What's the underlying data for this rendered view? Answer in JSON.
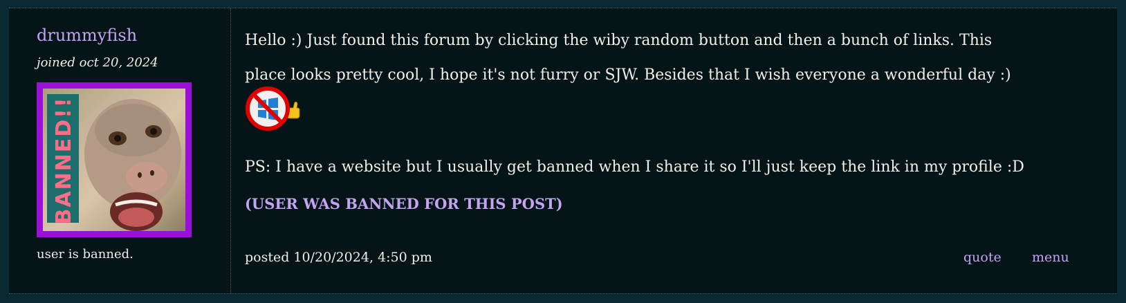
{
  "post": {
    "author": {
      "username": "drummyfish",
      "joined": "joined oct 20, 2024",
      "avatar_label": "BANNED!!",
      "status": "user is banned."
    },
    "body": {
      "text": "Hello :) Just found this forum by clicking the wiby random button and then a bunch of links. This place looks pretty cool, I hope it's not furry or SJW. Besides that I wish everyone a wonderful day :)",
      "ps": "PS: I have a website but I usually get banned when I share it so I'll just keep the link in my profile :D",
      "ban_notice": "(USER WAS BANNED FOR THIS POST)"
    },
    "footer": {
      "posted": "posted 10/20/2024, 4:50 pm",
      "quote_label": "quote",
      "menu_label": "menu"
    },
    "icons": {
      "smiley": "thumbs-up-smiley-icon",
      "no_windows": "no-windows-icon"
    },
    "colors": {
      "background": "#0a2a33",
      "panel": "#041417",
      "link": "#c4a3f0",
      "text": "#f2efe8",
      "avatar_border": "#9a10d8"
    }
  }
}
